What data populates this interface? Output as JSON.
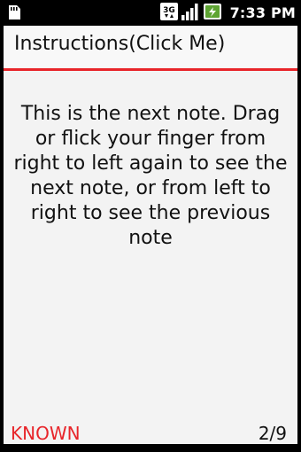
{
  "status_bar": {
    "time": "7:33 PM",
    "network_label": "3G",
    "icons": [
      "sd-card-icon",
      "network-3g-icon",
      "signal-icon",
      "battery-charging-icon"
    ]
  },
  "app": {
    "title": "Instructions(Click Me)",
    "note": "This is the next note. Drag or flick your finger from right to left again to see the next note, or from left to right to see the previous note",
    "known_label": "KNOWN",
    "page_counter": "2/9"
  },
  "colors": {
    "accent": "#e8252a",
    "background": "#f3f3f3",
    "text": "#111111"
  }
}
